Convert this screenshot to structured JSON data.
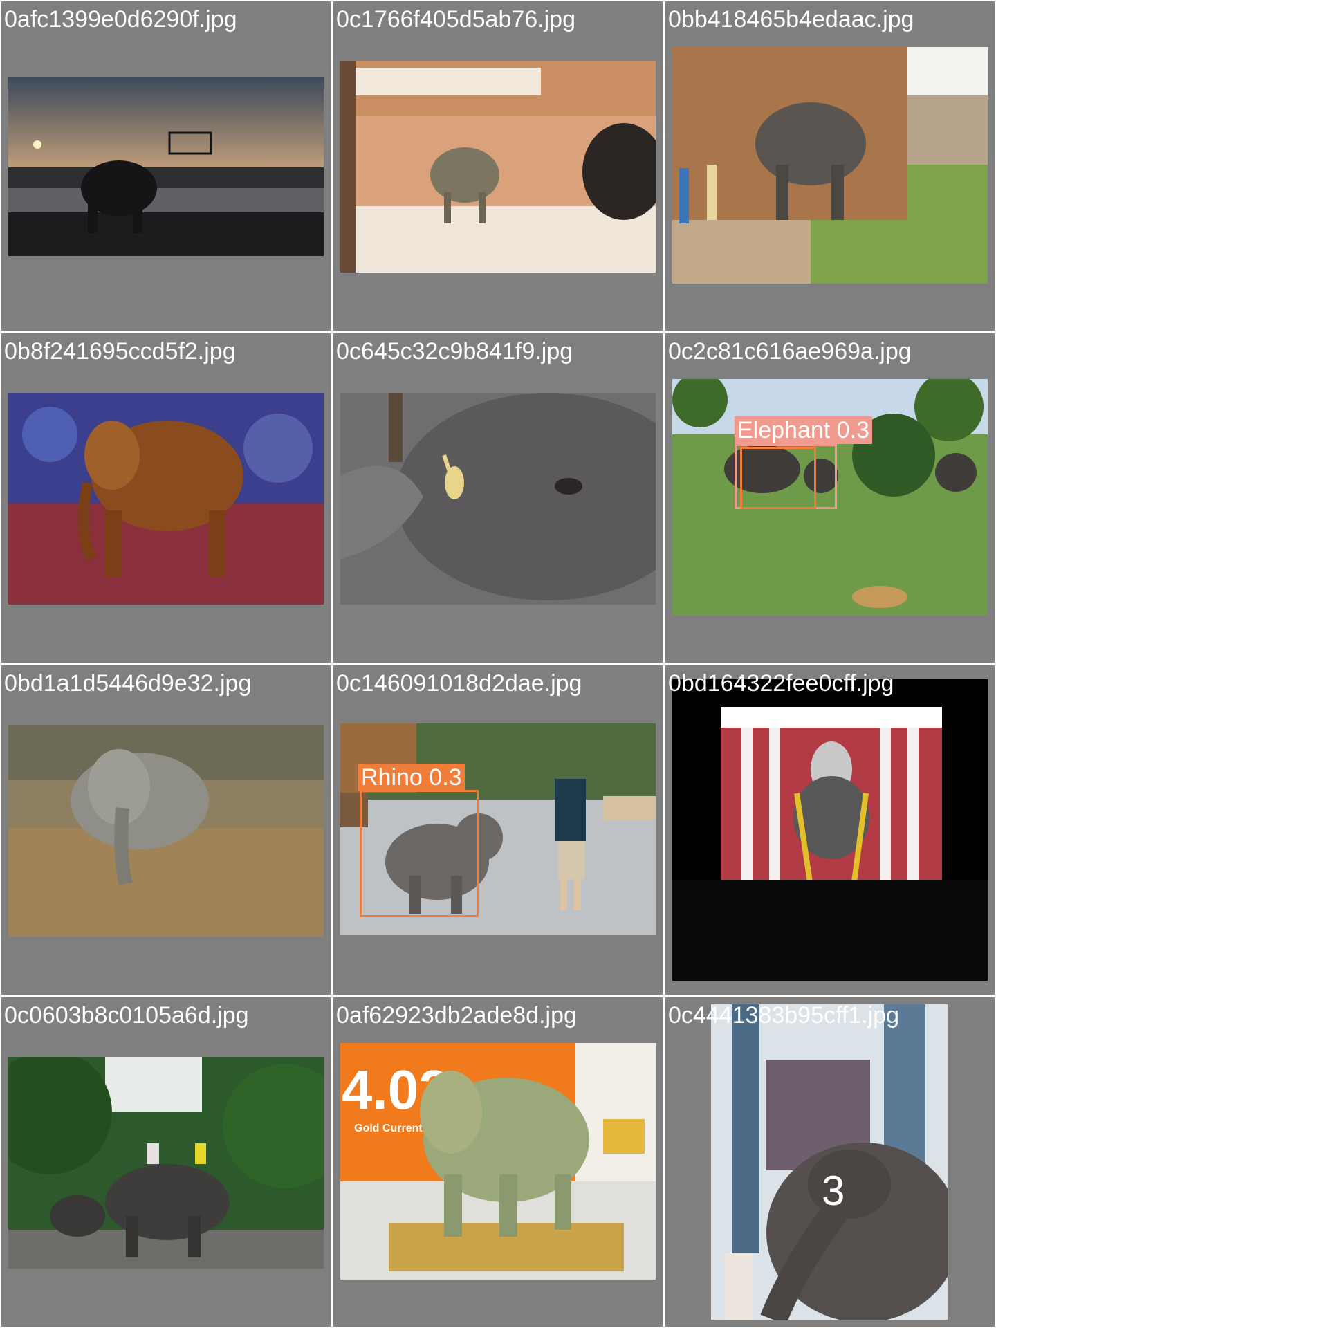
{
  "grid": {
    "cells": [
      {
        "filename": "0afc1399e0d6290f.jpg",
        "image": "silhouette of elephant with rider at sunset by river"
      },
      {
        "filename": "0c1766f405d5ab76.jpg",
        "image": "small carved elephant figurine and dark rhino figurine on window sill"
      },
      {
        "filename": "0bb418465b4edaac.jpg",
        "image": "elephant beside stone temple with people"
      },
      {
        "filename": "0b8f241695ccd5f2.jpg",
        "image": "wooden elephant carving on patterned carpet"
      },
      {
        "filename": "0c645c32c9b841f9.jpg",
        "image": "close-up of elephant eye and trunk"
      },
      {
        "filename": "0c2c81c616ae969a.jpg",
        "image": "elephants and cheetah in grassland",
        "detections": [
          {
            "label": "Elephant 0.3",
            "color": "#f19a8f"
          }
        ]
      },
      {
        "filename": "0bd1a1d5446d9e32.jpg",
        "image": "elephant in dry grass"
      },
      {
        "filename": "0c146091018d2dae.jpg",
        "image": "baby elephant with keeper",
        "detections": [
          {
            "label": "Rhino 0.3",
            "color": "#f07d3a"
          }
        ]
      },
      {
        "filename": "0bd164322fee0cff.jpg",
        "image": "Ganesh statue in shrine with worshippers"
      },
      {
        "filename": "0c0603b8c0105a6d.jpg",
        "image": "people riding elephants in forest"
      },
      {
        "filename": "0af62923db2ade8d.jpg",
        "image": "painted elephant sculpture in shop",
        "sign_text": "Gold Current"
      },
      {
        "filename": "0c4441383b95cff1.jpg",
        "image": "elephant with painted forehead near temple"
      }
    ]
  }
}
